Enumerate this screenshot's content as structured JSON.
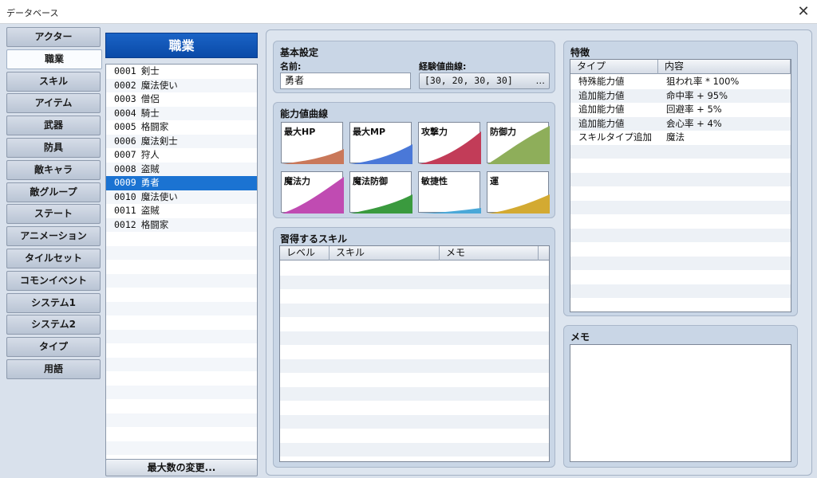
{
  "window": {
    "title": "データベース",
    "close_icon": "✕"
  },
  "tabs": [
    "アクター",
    "職業",
    "スキル",
    "アイテム",
    "武器",
    "防具",
    "敵キャラ",
    "敵グループ",
    "ステート",
    "アニメーション",
    "タイルセット",
    "コモンイベント",
    "システム1",
    "システム2",
    "タイプ",
    "用語"
  ],
  "active_tab": "職業",
  "list": {
    "header": "職業",
    "items": [
      {
        "id": "0001",
        "name": "剣士"
      },
      {
        "id": "0002",
        "name": "魔法使い"
      },
      {
        "id": "0003",
        "name": "僧侶"
      },
      {
        "id": "0004",
        "name": "騎士"
      },
      {
        "id": "0005",
        "name": "格闘家"
      },
      {
        "id": "0006",
        "name": "魔法剣士"
      },
      {
        "id": "0007",
        "name": "狩人"
      },
      {
        "id": "0008",
        "name": "盗賊"
      },
      {
        "id": "0009",
        "name": "勇者"
      },
      {
        "id": "0010",
        "name": "魔法使い"
      },
      {
        "id": "0011",
        "name": "盗賊"
      },
      {
        "id": "0012",
        "name": "格闘家"
      }
    ],
    "selected_index": 8,
    "max_button": "最大数の変更..."
  },
  "basic": {
    "title": "基本設定",
    "name_label": "名前:",
    "name_value": "勇者",
    "exp_label": "経験値曲線:",
    "exp_value": "[30, 20, 30, 30]",
    "exp_button": "…"
  },
  "curves": {
    "title": "能力値曲線",
    "items": [
      {
        "label": "最大HP",
        "color": "#c9785a"
      },
      {
        "label": "最大MP",
        "color": "#4a78d8"
      },
      {
        "label": "攻撃力",
        "color": "#c23c58"
      },
      {
        "label": "防御力",
        "color": "#8eae5a"
      },
      {
        "label": "魔法力",
        "color": "#c04bb2"
      },
      {
        "label": "魔法防御",
        "color": "#3a9a3e"
      },
      {
        "label": "敏捷性",
        "color": "#4aa8d8"
      },
      {
        "label": "運",
        "color": "#d3aa32"
      }
    ]
  },
  "skills": {
    "title": "習得するスキル",
    "columns": [
      "レベル",
      "スキル",
      "メモ"
    ]
  },
  "traits": {
    "title": "特徴",
    "columns": [
      "タイプ",
      "内容"
    ],
    "rows": [
      {
        "type": "特殊能力値",
        "content": "狙われ率 * 100%"
      },
      {
        "type": "追加能力値",
        "content": "命中率 + 95%"
      },
      {
        "type": "追加能力値",
        "content": "回避率 + 5%"
      },
      {
        "type": "追加能力値",
        "content": "会心率 + 4%"
      },
      {
        "type": "スキルタイプ追加",
        "content": "魔法"
      }
    ]
  },
  "memo": {
    "title": "メモ",
    "value": ""
  }
}
